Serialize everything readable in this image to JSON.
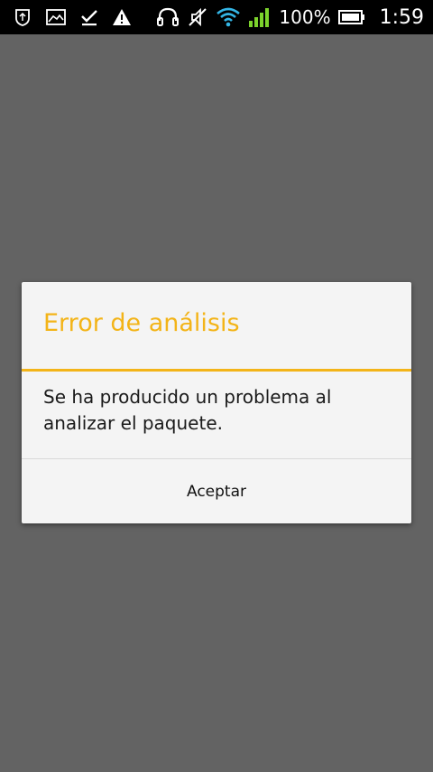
{
  "status_bar": {
    "left_icons": [
      "shield-notification-icon",
      "image-notification-icon",
      "download-done-icon",
      "warning-icon"
    ],
    "right_icons": [
      "headset-icon",
      "vibrate-off-icon",
      "wifi-icon",
      "signal-icon",
      "battery-icon"
    ],
    "battery_percent": "100%",
    "time": "1:59",
    "signal_color": "#7cd32c",
    "wifi_color": "#33b5e5"
  },
  "dialog": {
    "title": "Error de análisis",
    "message": "Se ha producido un problema al analizar el paquete.",
    "button_label": "Aceptar",
    "accent_color": "#f3b418"
  },
  "colors": {
    "background_dim": "#636363",
    "dialog_bg": "#f4f4f4"
  }
}
